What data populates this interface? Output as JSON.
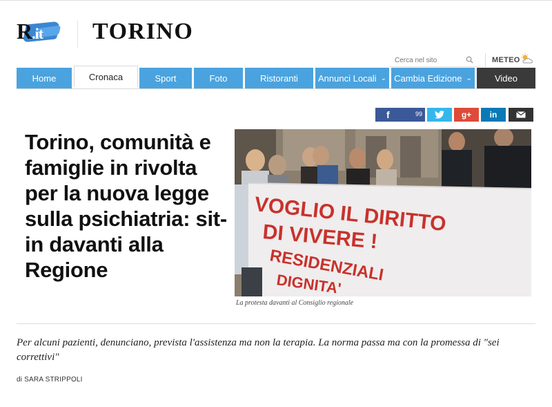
{
  "header": {
    "logo_text": "R",
    "logo_suffix": ".it",
    "city": "TORINO",
    "search_placeholder": "Cerca nel sito",
    "meteo_label": "METEO"
  },
  "nav": {
    "tabs": [
      {
        "label": "Home"
      },
      {
        "label": "Cronaca"
      },
      {
        "label": "Sport"
      },
      {
        "label": "Foto"
      },
      {
        "label": "Ristoranti"
      },
      {
        "label": "Annunci Locali"
      },
      {
        "label": "Cambia Edizione"
      },
      {
        "label": "Video"
      }
    ]
  },
  "share": {
    "facebook_label": "f",
    "facebook_count": "99",
    "twitter_icon": "twitter-icon",
    "gplus_label": "g+",
    "linkedin_label": "in",
    "email_icon": "envelope-icon"
  },
  "article": {
    "headline": "Torino, comunità e famiglie in rivolta per la nuova legge sulla psichiatria: sit-in davanti alla Regione",
    "photo_caption": "La protesta davanti al Consiglio regionale",
    "banner_text": "VOGLIO IL DIRITTO DI VIVERE RESIDENZIALI DIGNITA'",
    "summary": "Per alcuni pazienti, denunciano, prevista l'assistenza ma non la terapia. La norma passa ma con la promessa di \"sei correttivi\"",
    "byline": "di SARA STRIPPOLI"
  },
  "colors": {
    "nav_blue": "#4aa3df",
    "nav_dark": "#3a3a3a",
    "facebook": "#3b5998",
    "twitter": "#35b7ec",
    "gplus": "#dd4b39",
    "linkedin": "#0b79b5"
  }
}
